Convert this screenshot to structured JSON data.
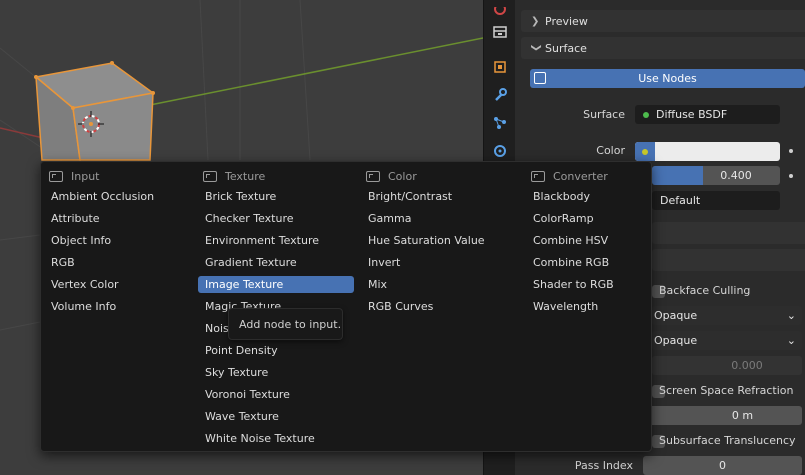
{
  "properties": {
    "preview_label": "Preview",
    "surface_label": "Surface",
    "use_nodes_label": "Use Nodes",
    "surface_row_label": "Surface",
    "surface_value": "Diffuse BSDF",
    "color_row_label": "Color",
    "roughness_value": "0.400",
    "normal_value": "Default",
    "backface_culling_label": "Backface Culling",
    "blend_mode_value": "Opaque",
    "shadow_mode_value": "Opaque",
    "clip_threshold_value": "0.000",
    "ssr_label": "Screen Space Refraction",
    "refraction_depth_value": "0 m",
    "sss_label": "Subsurface Translucency",
    "pass_index_label": "Pass Index",
    "pass_index_value": "0"
  },
  "tabs": [
    "material-icon",
    "object-icon",
    "wrench-icon",
    "particles-icon",
    "physics-icon"
  ],
  "menu": {
    "columns": [
      {
        "title": "Input",
        "items": [
          "Ambient Occlusion",
          "Attribute",
          "Object Info",
          "RGB",
          "Vertex Color",
          "Volume Info"
        ]
      },
      {
        "title": "Texture",
        "items": [
          "Brick Texture",
          "Checker Texture",
          "Environment Texture",
          "Gradient Texture",
          "Image Texture",
          "Magic Texture",
          "Noise Texture",
          "Point Density",
          "Sky Texture",
          "Voronoi Texture",
          "Wave Texture",
          "White Noise Texture"
        ]
      },
      {
        "title": "Color",
        "items": [
          "Bright/Contrast",
          "Gamma",
          "Hue Saturation Value",
          "Invert",
          "Mix",
          "RGB Curves"
        ]
      },
      {
        "title": "Converter",
        "items": [
          "Blackbody",
          "ColorRamp",
          "Combine HSV",
          "Combine RGB",
          "Shader to RGB",
          "Wavelength"
        ]
      }
    ],
    "active_item": "Image Texture",
    "tooltip": "Add node to input."
  },
  "colors": {
    "accent": "#4772b3",
    "socket_yellow": "#c7c729",
    "socket_green": "#4dbb4d",
    "selection_orange": "#e8963a"
  }
}
